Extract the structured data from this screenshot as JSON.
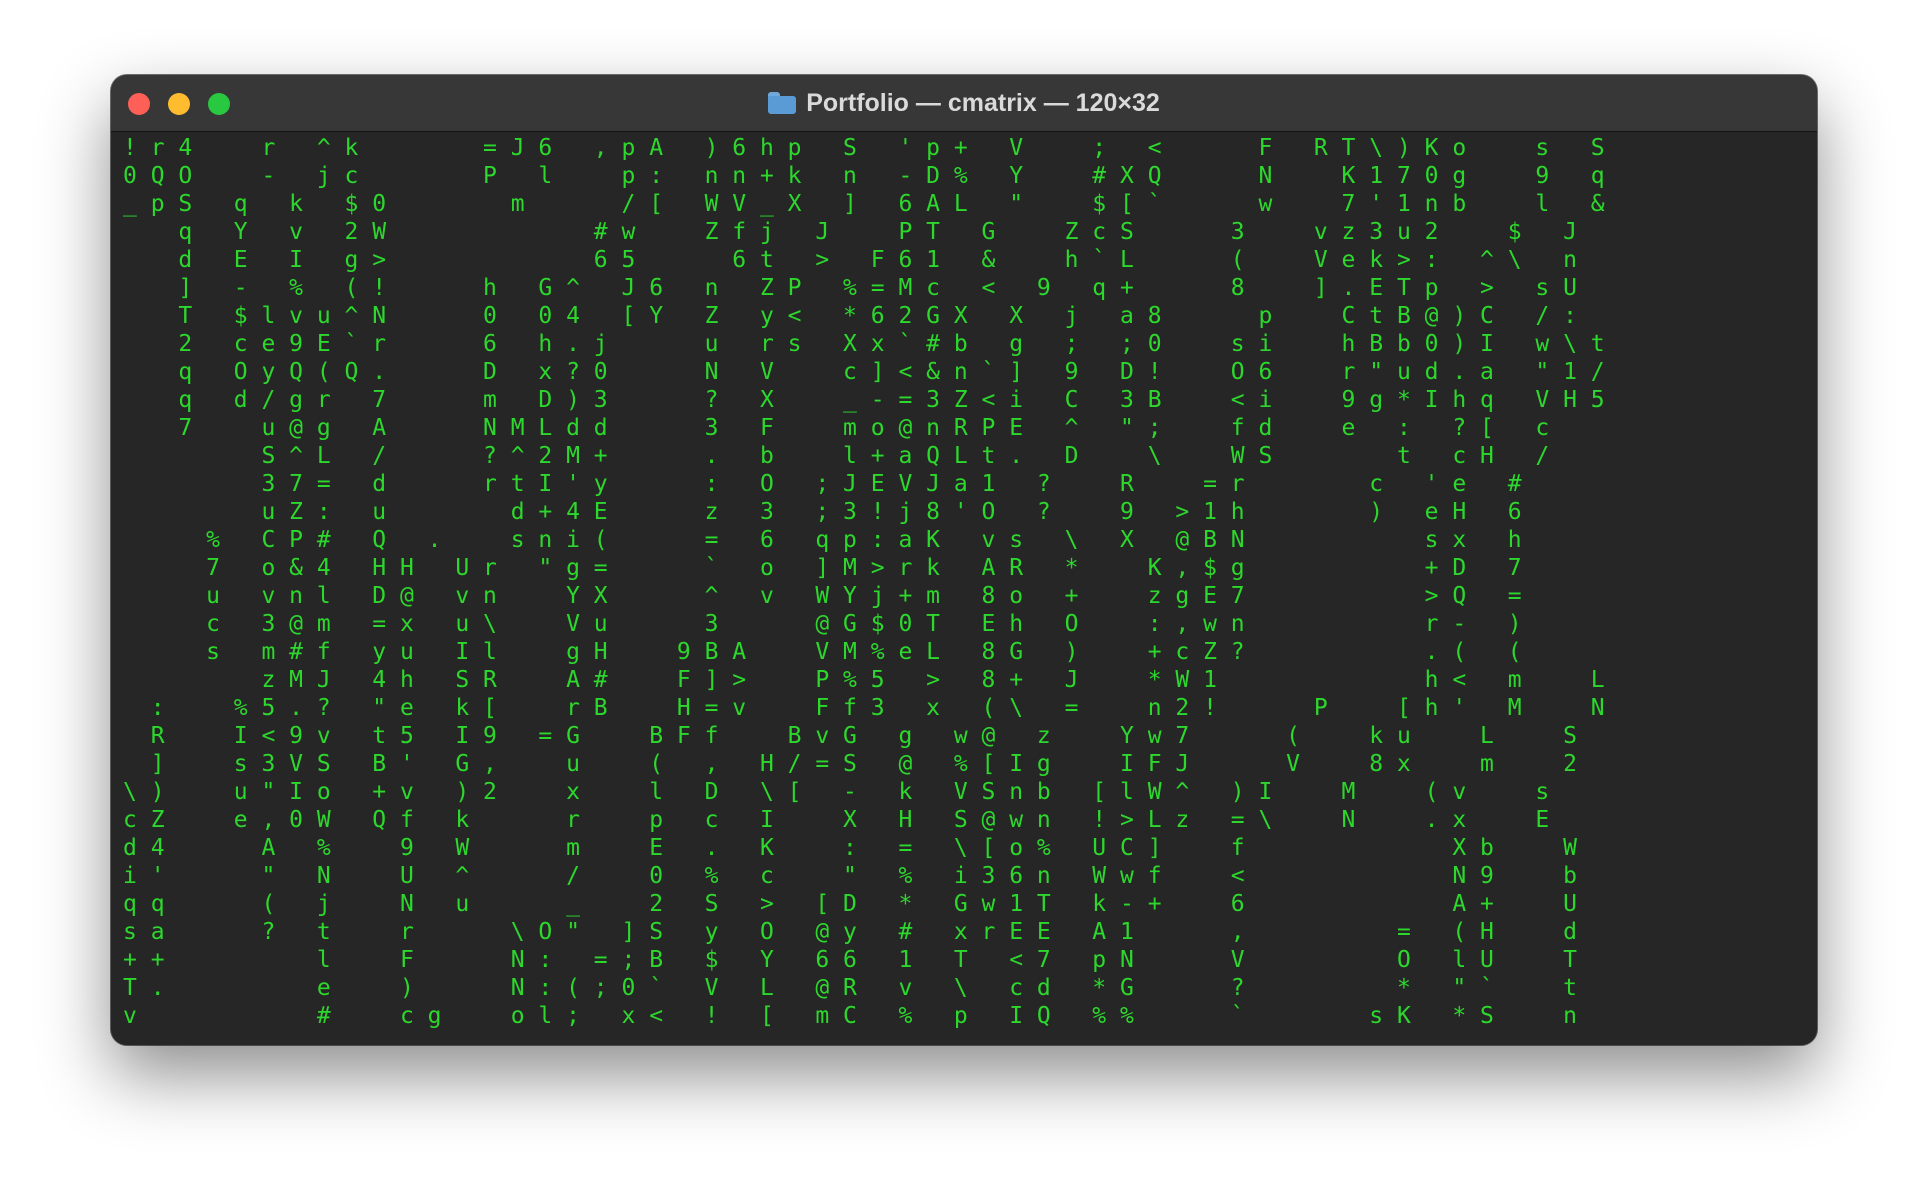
{
  "window": {
    "title": "Portfolio — cmatrix — 120×32",
    "folder_icon": "folder-icon",
    "traffic_lights": {
      "close": "#fe5f57",
      "minimize": "#febc2e",
      "zoom": "#28c840"
    }
  },
  "terminal": {
    "foreground": "#2dd82d",
    "background": "#262626",
    "lines": [
      "! r 4     r   ^ k         = J 6   , p A   ) 6 h p   S   ' p +   V     ;   <       F   R T \\ ) K o     s   S",
      "0 Q O     -   j c         P   l     p :   n n + k   n   - D %   Y     # X Q       N     K 1 7 0 g     9   q",
      "_ p S   q   k   $ 0         m       / [   W V _ X   ]   6 A L   \"     $ [ `       w     7 ' 1 n b     l   &",
      "    q   Y   v   2 W               # w     Z f j   J     P T   G     Z c S       3     v z 3 u 2     $   J",
      "    d   E   I   g >               6 5       6 t   >   F 6 1   &     h ` L       (     V e k > :   ^ \\   n",
      "    ]   -   %   ( !       h   G ^   J 6   n   Z P   % = M c   <   9   q +       8     ] . E T p   >   s U",
      "    T   $ l v u ^ N       0   0 4   [ Y   Z   y <   * 6 2 G X   X   j   a 8       p     C t B @ ) C   / :",
      "    2   c e 9 E ` r       6   h . j       u   r s   X x ` # b   g   ;   ; 0     s i     h B b 0 ) I   w \\ t",
      "    q   O y Q ( Q .       D   x ? 0       N   V     c ] < & n ` ]   9   D !     O 6     r \" u d . a   \" 1 /",
      "    q   d / g r   7       m   D ) 3       ?   X     _ - = 3 Z < i   C   3 B     < i     9 g * I h q   V H 5",
      "    7     u @ g   A       N M L d d       3   F     m o @ n R P E   ^   \" ;     f d     e   :   ? [   c",
      "          S ^ L   /       ? ^ 2 M +       .   b     l + a Q L t .   D     \\     W S         t   c H   /",
      "          3 7 =   d       r t I ' y       :   O   ; J E V J a 1   ?     R     = r         c   ' e   #",
      "          u Z :   u         d + 4 E       z   3   ; 3 ! j 8 ' O   ?     9   > 1 h         )   e H   6",
      "      %   C P #   Q   .     s n i (       =   6   q p : a K   v s   \\   X   @ B N             s x   h",
      "      7   o & 4   H H   U r   \" g =       `   o   ] M > r k   A R   *     K , $ g             + D   7",
      "      u   v n l   D @   v n     Y X       ^   v   W Y j + m   8 o   +     z g E 7             > Q   =",
      "      c   3 @ m   = x   u \\     V u       3       @ G $ 0 T   E h   O     : , w n             r -   )",
      "      s   m # f   y u   I l     g H     9 B A     V M % e L   8 G   )     + c Z ?             . (   (",
      "          z M J   4 h   S R     A #     F ] >     P % 5   >   8 +   J     * W 1               h <   m     L",
      "  :     % 5 . ?   \" e   k [     r B     H = v     F f 3   x   ( \\   =     n 2 !       P     [ h '   M     N",
      "  R     I < 9 v   t 5   I 9   = G     B F f     B v G   g   w @   z     Y w 7       (     k u     L     S",
      "  ]     s 3 V S   B '   G ,     u     (   ,   H / = S   @   % [ I g     I F J       V     8 x     m     2",
      "\\ )     u \" I o   + v   ) 2     x     l   D   \\ [   -   k   V S n b   [ l W ^   ) I     M     ( v     s",
      "c Z     e , 0 W   Q f   k       r     p   c   I     X   H   S @ w n   ! > L z   = \\     N     . x     E",
      "d 4       A   %     9   W       m     E   .   K     :   =   \\ [ o %   U C ]     f               X b     W",
      "i '       \"   N     U   ^       /     0   %   c     \"   %   i 3 6 n   W w f     <               N 9     b",
      "q q       (   j     N   u       _     2   S   >   [ D   *   G w 1 T   k - +     6               A +     U",
      "s a       ?   t     r       \\ O \"   ] S   y   O   @ y   #   x r E E   A 1       ,           =   ( H     d",
      "+ +           l     F       N :   = ; B   $   Y   6 6   1   T   < 7   p N       V           O   l U     T",
      "T .           e     )       N : ( ; 0 `   V   L   @ R   v   \\   c d   * G       ?           *   \" `     t",
      "v             #     c g     o l ;   x <   !   [   m C   %   p   I Q   % %       `         s K   * S     n"
    ]
  }
}
